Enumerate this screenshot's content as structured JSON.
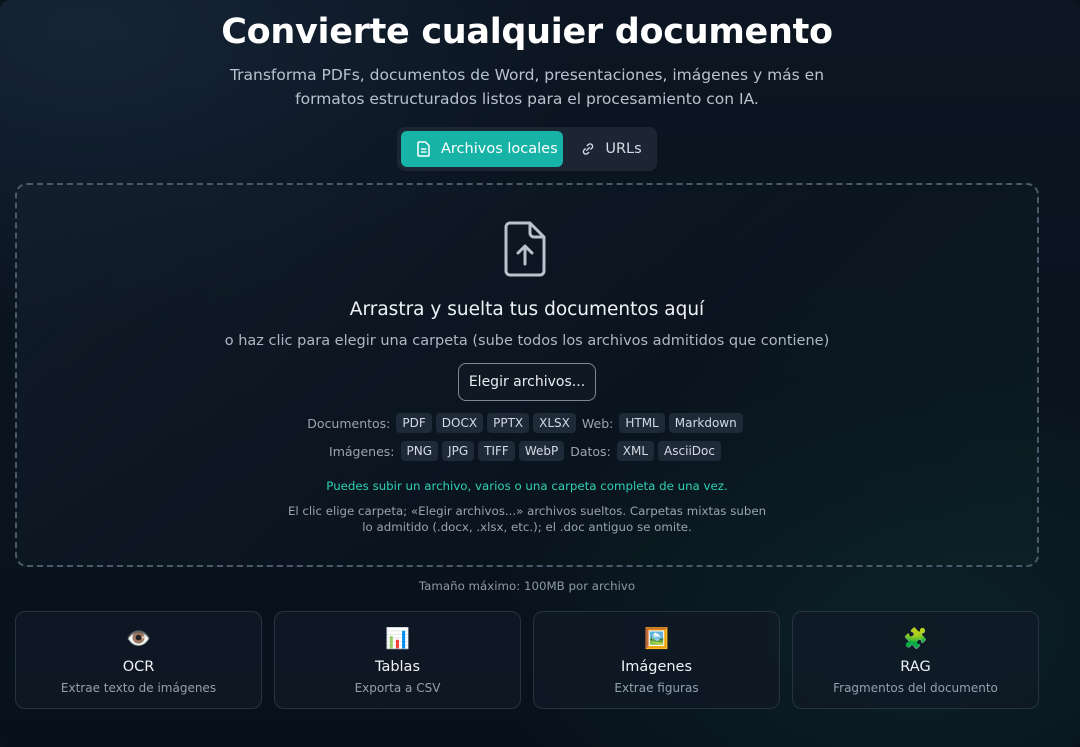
{
  "header": {
    "title": "Convierte cualquier documento",
    "subtitle": "Transforma PDFs, documentos de Word, presentaciones, imágenes y más en formatos estructurados listos para el procesamiento con IA."
  },
  "tabs": [
    {
      "label": "Archivos locales",
      "icon": "document-icon",
      "active": true
    },
    {
      "label": "URLs",
      "icon": "link-icon",
      "active": false
    }
  ],
  "dropzone": {
    "icon": "file-upload-icon",
    "heading": "Arrastra y suelta tus documentos aquí",
    "subheading": "o haz clic para elegir una carpeta (sube todos los archivos admitidos que contiene)",
    "choose_button": "Elegir archivos...",
    "formats": {
      "documentos_label": "Documentos:",
      "documentos": [
        "PDF",
        "DOCX",
        "PPTX",
        "XLSX"
      ],
      "web_label": "Web:",
      "web": [
        "HTML",
        "Markdown"
      ],
      "imagenes_label": "Imágenes:",
      "imagenes": [
        "PNG",
        "JPG",
        "TIFF",
        "WebP"
      ],
      "datos_label": "Datos:",
      "datos": [
        "XML",
        "AsciiDoc"
      ]
    },
    "note_green": "Puedes subir un archivo, varios o una carpeta completa de una vez.",
    "note_gray": "El clic elige carpeta; «Elegir archivos...» archivos sueltos. Carpetas mixtas suben lo admitido (.docx, .xlsx, etc.); el .doc antiguo se omite."
  },
  "max_size": "Tamaño máximo: 100MB por archivo",
  "features": [
    {
      "icon": "eye-icon",
      "glyph": "👁️",
      "title": "OCR",
      "desc": "Extrae texto de imágenes"
    },
    {
      "icon": "bar-chart-icon",
      "glyph": "📊",
      "title": "Tablas",
      "desc": "Exporta a CSV"
    },
    {
      "icon": "picture-icon",
      "glyph": "🖼️",
      "title": "Imágenes",
      "desc": "Extrae figuras"
    },
    {
      "icon": "puzzle-icon",
      "glyph": "🧩",
      "title": "RAG",
      "desc": "Fragmentos del documento"
    }
  ],
  "colors": {
    "accent": "#17b3a6",
    "note_green": "#2fd0b4",
    "background": "#0a121c"
  }
}
